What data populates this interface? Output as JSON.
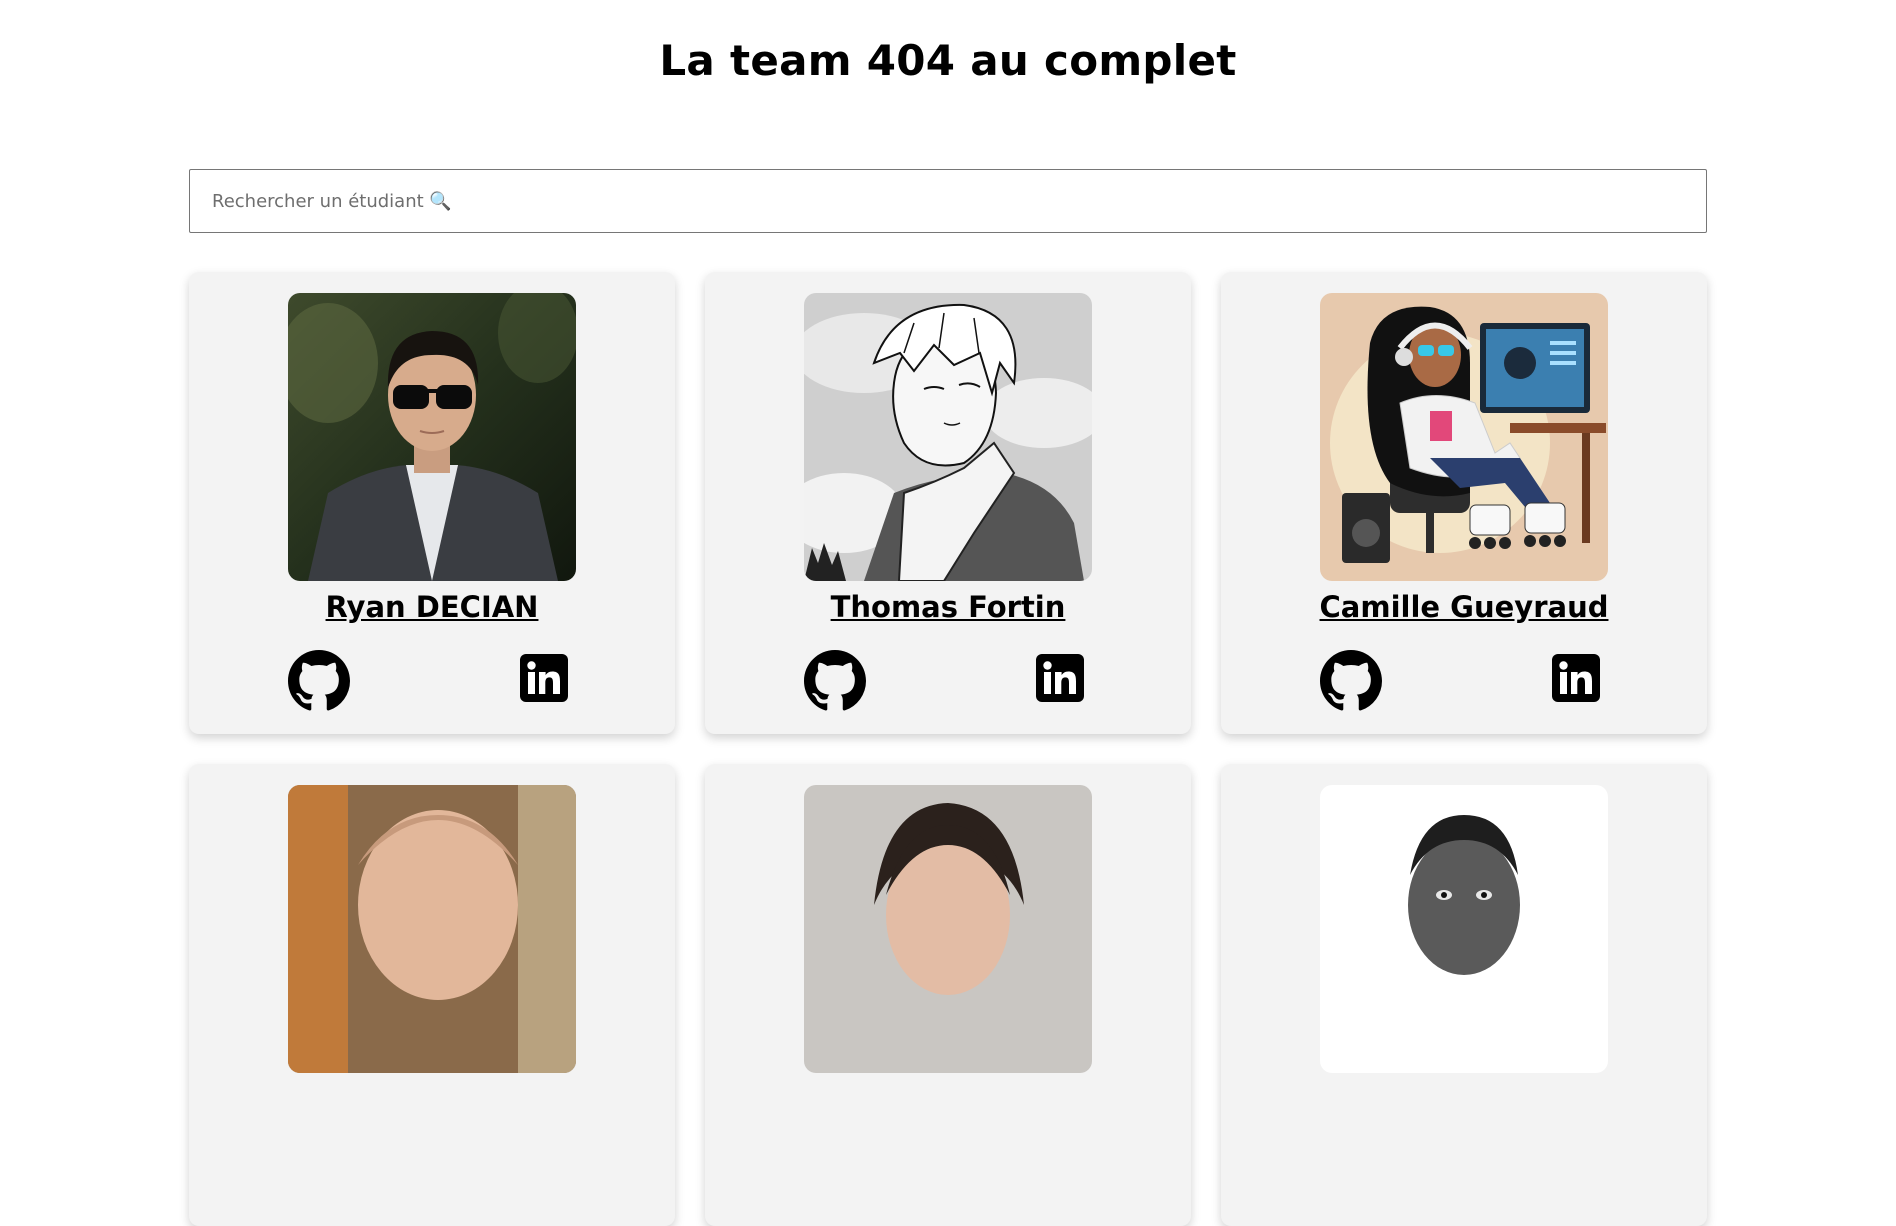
{
  "page": {
    "title": "La team 404 au complet"
  },
  "search": {
    "placeholder": "Rechercher un étudiant 🔍",
    "value": ""
  },
  "members": [
    {
      "name": "Ryan DECIAN",
      "photo": "photo-man-sunglasses-blazer",
      "icons": [
        "github-icon",
        "linkedin-icon"
      ]
    },
    {
      "name": "Thomas Fortin",
      "photo": "manga-style-drawing-young-man-towel",
      "icons": [
        "github-icon",
        "linkedin-icon"
      ]
    },
    {
      "name": "Camille Gueyraud",
      "photo": "illustration-girl-roller-skates-computer",
      "icons": [
        "github-icon",
        "linkedin-icon"
      ]
    },
    {
      "name": "",
      "photo": "photo-bald-man"
    },
    {
      "name": "",
      "photo": "photo-woman-dark-hair"
    },
    {
      "name": "",
      "photo": "photo-man-black-and-white"
    }
  ],
  "colors": {
    "card_background": "#f3f3f3",
    "text": "#000000",
    "search_border": "#767676"
  }
}
